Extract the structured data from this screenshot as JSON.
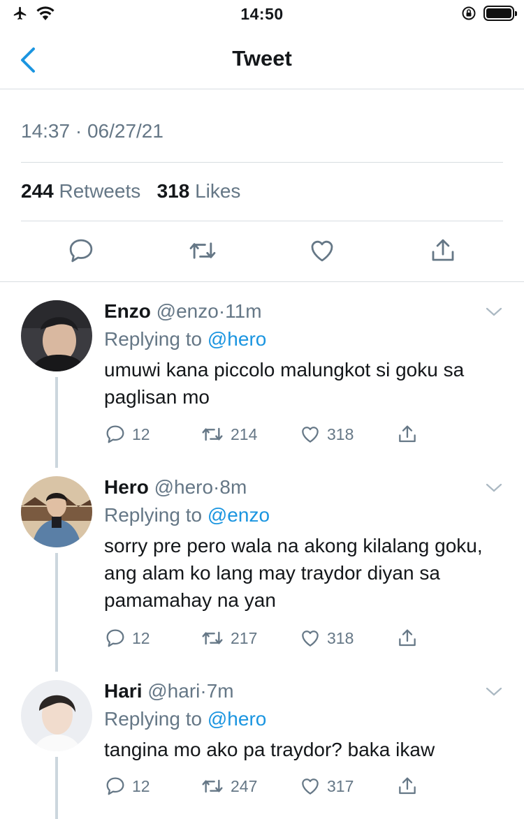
{
  "status_bar": {
    "time": "14:50"
  },
  "nav": {
    "title": "Tweet"
  },
  "tweet": {
    "timestamp": "14:37 · 06/27/21",
    "retweets_count": "244",
    "retweets_label": "Retweets",
    "likes_count": "318",
    "likes_label": "Likes"
  },
  "replies": [
    {
      "name": "Enzo",
      "handle": "@enzo",
      "dot": "·",
      "time": "11m",
      "replying_label": "Replying to",
      "replying_to": "@hero",
      "text": "umuwi kana piccolo malungkot si goku sa paglisan mo",
      "replies": "12",
      "retweets": "214",
      "likes": "318"
    },
    {
      "name": "Hero",
      "handle": "@hero",
      "dot": "·",
      "time": "8m",
      "replying_label": "Replying to",
      "replying_to": "@enzo",
      "text": "sorry pre pero wala na akong kilalang goku, ang alam ko lang may traydor diyan sa pamamahay na yan",
      "replies": "12",
      "retweets": "217",
      "likes": "318"
    },
    {
      "name": "Hari",
      "handle": "@hari",
      "dot": "·",
      "time": "7m",
      "replying_label": "Replying to",
      "replying_to": "@hero",
      "text": "tangina mo ako pa traydor? baka ikaw",
      "replies": "12",
      "retweets": "247",
      "likes": "317"
    }
  ],
  "colors": {
    "accent": "#1b95e0",
    "muted": "#657786",
    "divider": "#d8dde1",
    "thread": "#ccd6dd"
  }
}
